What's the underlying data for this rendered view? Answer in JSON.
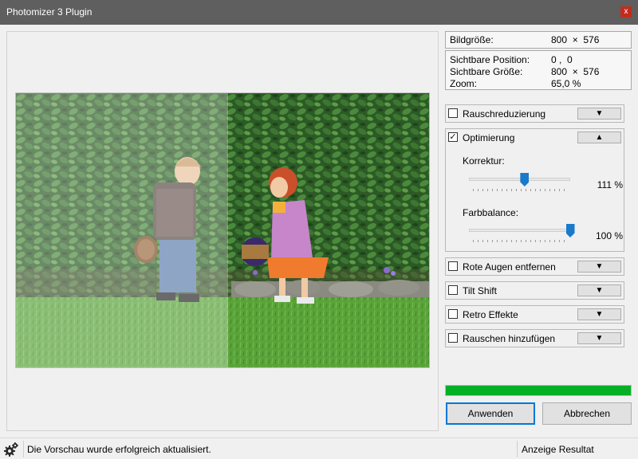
{
  "window": {
    "title": "Photomizer 3 Plugin",
    "close_glyph": "x"
  },
  "info": {
    "image_size_label": "Bildgröße:",
    "image_size_value": "800  ×  576",
    "visible_position_label": "Sichtbare Position:",
    "visible_position_value": "0 ,  0",
    "visible_size_label": "Sichtbare Größe:",
    "visible_size_value": "800  ×  576",
    "zoom_label": "Zoom:",
    "zoom_value": "65,0 %"
  },
  "sections": {
    "noise_reduction": {
      "label": "Rauschreduzierung",
      "checked": false,
      "toggle": "▼"
    },
    "optimization": {
      "label": "Optimierung",
      "checked": true,
      "check_glyph": "✓",
      "toggle": "▲",
      "correction_label": "Korrektur:",
      "correction_value": "111 %",
      "correction_level": 0.55,
      "color_balance_label": "Farbbalance:",
      "color_balance_value": "100 %",
      "color_balance_level": 1.0
    },
    "red_eye": {
      "label": "Rote Augen entfernen",
      "checked": false,
      "toggle": "▼"
    },
    "tilt_shift": {
      "label": "Tilt Shift",
      "checked": false,
      "toggle": "▼"
    },
    "retro": {
      "label": "Retro Effekte",
      "checked": false,
      "toggle": "▼"
    },
    "add_noise": {
      "label": "Rauschen hinzufügen",
      "checked": false,
      "toggle": "▼"
    }
  },
  "progress": {
    "percent": 100,
    "color": "#06b025"
  },
  "buttons": {
    "apply": "Anwenden",
    "cancel": "Abbrechen"
  },
  "status": {
    "message": "Die Vorschau wurde erfolgreich aktualisiert.",
    "view_mode": "Anzeige Resultat"
  },
  "icons": {
    "close": "close-icon",
    "gear": "gear-icon"
  }
}
